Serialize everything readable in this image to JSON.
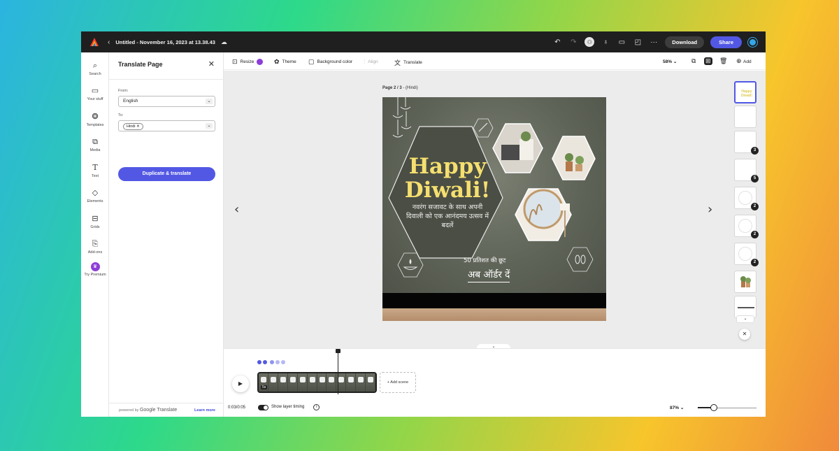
{
  "topbar": {
    "title": "Untitled - November 16, 2023 at 13.38.43",
    "download_label": "Download",
    "share_label": "Share",
    "brand_color": "#5258e4"
  },
  "rail": {
    "items": [
      {
        "label": "Search",
        "icon": "search-icon"
      },
      {
        "label": "Your stuff",
        "icon": "folder-icon"
      },
      {
        "label": "Templates",
        "icon": "templates-icon"
      },
      {
        "label": "Media",
        "icon": "media-icon"
      },
      {
        "label": "Text",
        "icon": "text-icon"
      },
      {
        "label": "Elements",
        "icon": "elements-icon"
      },
      {
        "label": "Grids",
        "icon": "grids-icon"
      },
      {
        "label": "Add-ons",
        "icon": "addons-icon"
      },
      {
        "label": "Try Premium",
        "icon": "crown-icon"
      }
    ]
  },
  "panel": {
    "title": "Translate Page",
    "from_label": "From:",
    "from_value": "English",
    "to_label": "To:",
    "to_chip": "Hindi",
    "duplicate_label": "Duplicate & translate",
    "powered_prefix": "powered by",
    "powered_brand": "Google Translate",
    "learn_more": "Learn more"
  },
  "toolbar": {
    "resize": "Resize",
    "theme": "Theme",
    "background": "Background color",
    "align": "Align",
    "translate": "Translate",
    "zoom": "58%",
    "add": "Add"
  },
  "canvas": {
    "page_number": "Page 2 / 3",
    "page_suffix": " - (Hindi)",
    "headline_1": "Happy",
    "headline_2": "Diwali!",
    "hindi_message_1": "नवरंग सजावट के साथ अपनी",
    "hindi_message_2": "दिवाली को एक आनंदमय उत्सव में",
    "hindi_message_3": "बदलें",
    "offer_text": "50 प्रतिशत की छूट",
    "order_text": "अब ऑर्डर दें"
  },
  "thumbnails": {
    "first_label": "Happy Diwali!",
    "badges": [
      "3",
      "5",
      "2",
      "2",
      "2"
    ]
  },
  "timeline": {
    "strip_time": "5s",
    "add_scene": "+ Add scene",
    "time": "0:03/0:05",
    "show_layer_timing": "Show layer timing",
    "zoom": "87%"
  }
}
